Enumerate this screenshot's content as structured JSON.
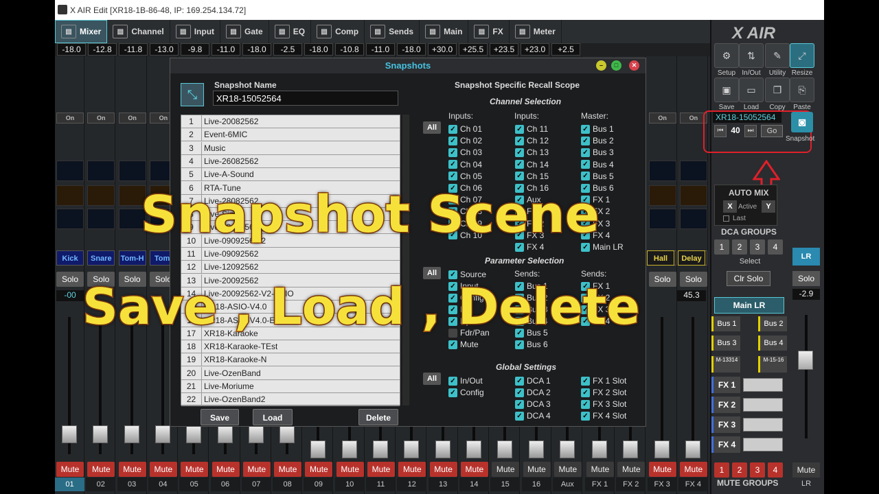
{
  "window": {
    "title": "X AIR Edit [XR18-1B-86-48, IP: 169.254.134.72]"
  },
  "tabs": [
    {
      "label": "Mixer",
      "icon": "mixer-icon"
    },
    {
      "label": "Channel",
      "icon": "channel-icon"
    },
    {
      "label": "Input",
      "icon": "input-icon"
    },
    {
      "label": "Gate",
      "icon": "gate-icon"
    },
    {
      "label": "EQ",
      "icon": "eq-icon"
    },
    {
      "label": "Comp",
      "icon": "comp-icon"
    },
    {
      "label": "Sends",
      "icon": "sends-icon"
    },
    {
      "label": "Main",
      "icon": "main-icon"
    },
    {
      "label": "FX",
      "icon": "fx-icon"
    },
    {
      "label": "Meter",
      "icon": "meter-icon"
    }
  ],
  "levels": [
    "-18.0",
    "-12.8",
    "-11.8",
    "-13.0",
    "-9.8",
    "-11.0",
    "-18.0",
    "-2.5",
    "-18.0",
    "-10.8",
    "-11.0",
    "-18.0",
    "+30.0",
    "+25.5",
    "+23.5",
    "+23.0",
    "+2.5"
  ],
  "channels": {
    "names": [
      "Kick",
      "Snare",
      "Tom-H",
      "Tom-"
    ],
    "fx_names": [
      "Hall",
      "Delay"
    ],
    "solo": "Solo",
    "on": "On",
    "mute": "Mute",
    "numbers": [
      "01",
      "02",
      "03",
      "04",
      "05",
      "06",
      "07",
      "08",
      "09",
      "10",
      "11",
      "12",
      "13",
      "14",
      "15",
      "16",
      "Aux",
      "FX 1",
      "FX 2",
      "FX 3",
      "FX 4"
    ],
    "fx_level": "45.3",
    "ch1_level": "-00"
  },
  "right_panel": {
    "logo": "X AIR",
    "buttons": [
      {
        "label": "Setup",
        "icon": "gear-icon"
      },
      {
        "label": "In/Out",
        "icon": "inout-icon"
      },
      {
        "label": "Utility",
        "icon": "wrench-icon"
      },
      {
        "label": "Resize",
        "icon": "resize-icon"
      },
      {
        "label": "Save",
        "icon": "save-icon"
      },
      {
        "label": "Load",
        "icon": "folder-icon"
      },
      {
        "label": "Copy",
        "icon": "copy-icon"
      },
      {
        "label": "Paste",
        "icon": "paste-icon"
      }
    ],
    "snapshot_name": "XR18-15052564",
    "snapshot_index": "40",
    "go": "Go",
    "snapshot_label": "Snapshot",
    "automix": {
      "title": "AUTO MIX",
      "x": "X",
      "y": "Y",
      "active": "Active",
      "last": "Last"
    },
    "dca_title": "DCA GROUPS",
    "dca": [
      "1",
      "2",
      "3",
      "4"
    ],
    "select": "Select",
    "clr_solo": "Clr Solo",
    "main_lr": "Main LR",
    "lr": "LR",
    "lr_solo": "Solo",
    "lr_level": "-2.9",
    "buses": [
      "Bus 1",
      "Bus 2",
      "Bus 3",
      "Bus 4",
      "M-13314",
      "M-15-16"
    ],
    "fx": [
      "FX 1",
      "FX 2",
      "FX 3",
      "FX 4"
    ],
    "mute_groups_title": "MUTE GROUPS",
    "mute_groups": [
      "1",
      "2",
      "3",
      "4"
    ],
    "lr_mute": "Mute",
    "lr_num": "LR"
  },
  "dialog": {
    "title": "Snapshots",
    "name_label": "Snapshot Name",
    "name_value": "XR18-15052564",
    "snapshots": [
      {
        "n": "1",
        "t": "Live-20082562"
      },
      {
        "n": "2",
        "t": "Event-6MIC"
      },
      {
        "n": "3",
        "t": "Music"
      },
      {
        "n": "4",
        "t": "Live-26082562"
      },
      {
        "n": "5",
        "t": "Live-A-Sound"
      },
      {
        "n": "6",
        "t": "RTA-Tune"
      },
      {
        "n": "7",
        "t": "Live-28082562"
      },
      {
        "n": "8",
        "t": "Live-Sing"
      },
      {
        "n": "9",
        "t": "Live-09092562"
      },
      {
        "n": "10",
        "t": "Live-09092562-2"
      },
      {
        "n": "11",
        "t": "Live-09092562"
      },
      {
        "n": "12",
        "t": "Live-12092562"
      },
      {
        "n": "13",
        "t": "Live-20092562"
      },
      {
        "n": "14",
        "t": "Live-20092562-V2-ASIO"
      },
      {
        "n": "15",
        "t": "XR18-ASIO-V4.0"
      },
      {
        "n": "16",
        "t": "XR18-ASIO-V4.0-E"
      },
      {
        "n": "17",
        "t": "XR18-Karaoke"
      },
      {
        "n": "18",
        "t": "XR18-Karaoke-TEst"
      },
      {
        "n": "19",
        "t": "XR18-Karaoke-N"
      },
      {
        "n": "20",
        "t": "Live-OzenBand"
      },
      {
        "n": "21",
        "t": "Live-Moriume"
      },
      {
        "n": "22",
        "t": "Live-OzenBand2"
      }
    ],
    "buttons": {
      "save": "Save",
      "load": "Load",
      "delete": "Delete"
    },
    "scope_title": "Snapshot Specific Recall Scope",
    "channel_selection": "Channel Selection",
    "all": "All",
    "col_inputs": "Inputs:",
    "col_master": "Master:",
    "inputs1": [
      "Ch 01",
      "Ch 02",
      "Ch 03",
      "Ch 04",
      "Ch 05",
      "Ch 06",
      "Ch 07",
      "Ch 08",
      "Ch 09",
      "Ch 10"
    ],
    "inputs2": [
      "Ch 11",
      "Ch 12",
      "Ch 13",
      "Ch 14",
      "Ch 15",
      "Ch 16",
      "Aux",
      "FX 1",
      "FX 2",
      "FX 3",
      "FX 4"
    ],
    "master": [
      "Bus 1",
      "Bus 2",
      "Bus 3",
      "Bus 4",
      "Bus 5",
      "Bus 6",
      "FX 1",
      "FX 2",
      "FX 3",
      "FX 4",
      "Main LR"
    ],
    "parameter_selection": "Parameter Selection",
    "params": [
      {
        "label": "Source",
        "checked": true
      },
      {
        "label": "Input",
        "checked": true
      },
      {
        "label": "Config",
        "checked": true
      },
      {
        "label": "EQ",
        "checked": true
      },
      {
        "label": "Dyn",
        "checked": true
      },
      {
        "label": "Fdr/Pan",
        "checked": false
      },
      {
        "label": "Mute",
        "checked": true
      }
    ],
    "sends_label": "Sends:",
    "sends_bus": [
      "Bus 1",
      "Bus 2",
      "Bus 3",
      "Bus 4",
      "Bus 5",
      "Bus 6"
    ],
    "sends_fx": [
      "FX 1",
      "FX 2",
      "FX 3",
      "FX 4"
    ],
    "global_settings": "Global Settings",
    "global1": [
      "In/Out",
      "Config"
    ],
    "global2": [
      "DCA 1",
      "DCA 2",
      "DCA 3",
      "DCA 4"
    ],
    "global3": [
      "FX 1 Slot",
      "FX 2 Slot",
      "FX 3 Slot",
      "FX 4 Slot"
    ]
  },
  "overlay": {
    "line1": "Snapshot Scene",
    "line2": "Save , Load , Delete"
  }
}
